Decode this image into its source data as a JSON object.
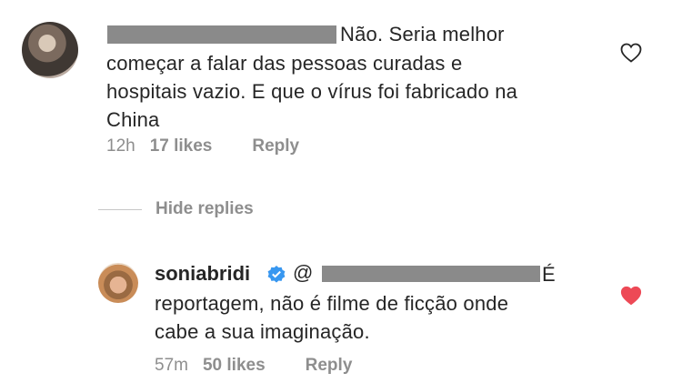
{
  "comment1": {
    "text_lines": [
      "Não. Seria melhor",
      "começar a falar das pessoas curadas e",
      "hospitais vazio. E que o vírus foi fabricado na",
      "China"
    ],
    "time": "12h",
    "likes": "17 likes",
    "reply_label": "Reply",
    "liked": false
  },
  "hide_replies_label": "Hide replies",
  "reply1": {
    "username": "soniabridi",
    "verified": true,
    "mention_prefix": "@",
    "text_lines": [
      "É",
      "reportagem, não é filme de ficção onde",
      "cabe a sua imaginação."
    ],
    "time": "57m",
    "likes": "50 likes",
    "reply_label": "Reply",
    "liked": true
  },
  "colors": {
    "text": "#262626",
    "meta": "#8e8e8e",
    "heart_liked": "#ed4956",
    "verified": "#3897f0"
  }
}
